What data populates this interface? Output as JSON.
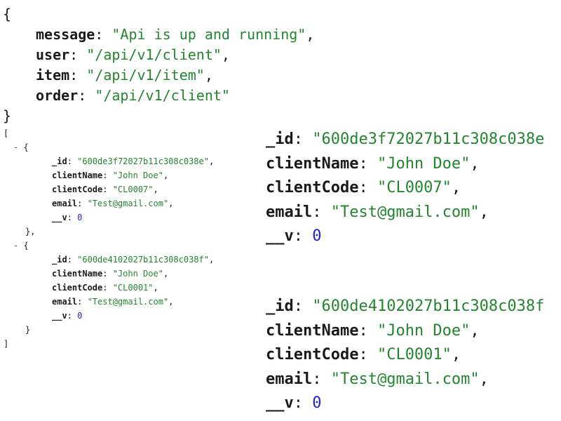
{
  "api_status": {
    "open_brace": "{",
    "close_brace": "}",
    "fields": [
      {
        "key": "message",
        "value": "\"Api is up and running\"",
        "sep": ","
      },
      {
        "key": "user",
        "value": "\"/api/v1/client\"",
        "sep": ","
      },
      {
        "key": "item",
        "value": "\"/api/v1/item\"",
        "sep": ","
      },
      {
        "key": "order",
        "value": "\"/api/v1/client\"",
        "sep": ""
      }
    ]
  },
  "client_list": {
    "open_bracket": "[",
    "close_bracket": "]",
    "toggle_symbol": "-",
    "object_open": "{",
    "object_close_1": "},",
    "object_close_2": "}",
    "records": [
      {
        "id_key": "_id",
        "id": "\"600de3f72027b11c308c038e\"",
        "name_key": "clientName",
        "name": "\"John Doe\"",
        "code_key": "clientCode",
        "code": "\"CL0007\"",
        "email_key": "email",
        "email": "\"Test@gmail.com\"",
        "v_key": "__v",
        "v": "0"
      },
      {
        "id_key": "_id",
        "id": "\"600de4102027b11c308c038f\"",
        "name_key": "clientName",
        "name": "\"John Doe\"",
        "code_key": "clientCode",
        "code": "\"CL0001\"",
        "email_key": "email",
        "email": "\"Test@gmail.com\"",
        "v_key": "__v",
        "v": "0"
      }
    ]
  },
  "zoom_records": [
    {
      "id_key": "_id",
      "id": "\"600de3f72027b11c308c038e",
      "name_key": "clientName",
      "name": "\"John Doe\"",
      "code_key": "clientCode",
      "code": "\"CL0007\"",
      "email_key": "email",
      "email": "\"Test@gmail.com\"",
      "v_key": "__v",
      "v": "0"
    },
    {
      "id_key": "_id",
      "id": "\"600de4102027b11c308c038f",
      "name_key": "clientName",
      "name": "\"John Doe\"",
      "code_key": "clientCode",
      "code": "\"CL0001\"",
      "email_key": "email",
      "email": "\"Test@gmail.com\"",
      "v_key": "__v",
      "v": "0"
    }
  ],
  "colors": {
    "key": "#1a1a1a",
    "string": "#22862e",
    "number": "#1f1fe0"
  }
}
